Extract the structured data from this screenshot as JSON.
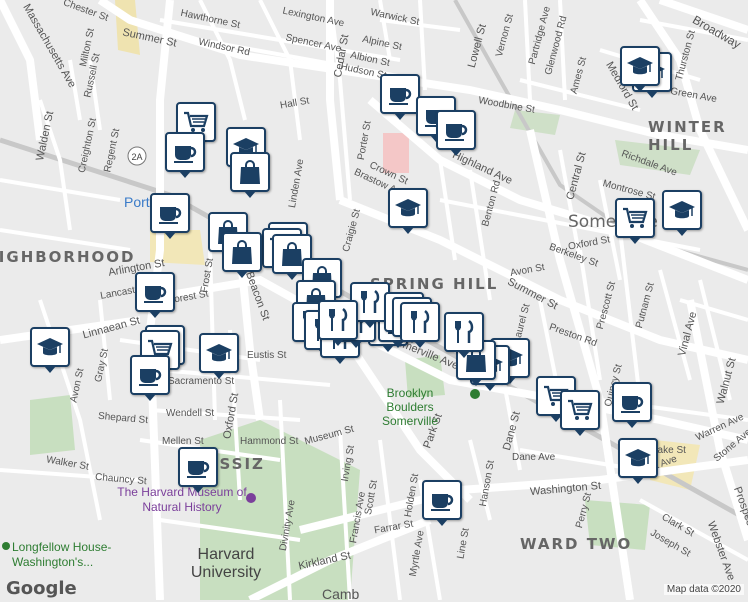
{
  "streets": [
    "Summer St",
    "Hawthorne St",
    "Windsor Rd",
    "Lexington Ave",
    "Spencer Ave",
    "Cedar St",
    "Alpine St",
    "Hudson St",
    "Albion St",
    "Warwick St",
    "Lowell St",
    "Vernon St",
    "Partridge Ave",
    "Glenwood Rd",
    "Ames St",
    "Central St",
    "Thurston St",
    "Medford St",
    "Broadway",
    "Woodbine St",
    "Green Ave",
    "Richdale Ave",
    "Highland Ave",
    "Montrose St",
    "Porter St",
    "Crown St",
    "Brastow Ave",
    "Benton Rd",
    "Oxford St",
    "Berkeley St",
    "Avon St",
    "Summer St",
    "Preston Rd",
    "Laurel St",
    "Prescott St",
    "Putnam St",
    "Vinal Ave",
    "Walnut St",
    "Quincy St",
    "Somerville Ave",
    "Craigie St",
    "Linden Ave",
    "Hall St",
    "Walden St",
    "Creighton St",
    "Regent St",
    "Russell St",
    "Milton St",
    "Chester St",
    "Massachusetts Ave",
    "Arlington St",
    "Lancaster St",
    "Forest St",
    "Frost St",
    "Beacon St",
    "Oxford St",
    "Linnaean St",
    "Avon St",
    "Gray St",
    "Eustis St",
    "Sacramento St",
    "Wendell St",
    "Shepard St",
    "Mellen St",
    "Hammond St",
    "Museum St",
    "Irving St",
    "Scott St",
    "Francis Ave",
    "Holden St",
    "Farrar St",
    "Myrtle Ave",
    "Line St",
    "Dane Ave",
    "Hanson St",
    "Park St",
    "Dane St",
    "Washington St",
    "Kirkland St",
    "Walker St",
    "Chauncy St",
    "Divinity Ave",
    "Perry St",
    "Clark St",
    "Joseph St",
    "Webster Ave",
    "Stone Ave",
    "Warren Ave",
    "Park Ave",
    "Prospect St",
    "Lake St"
  ],
  "neighborhoods": [
    "WINTER HILL",
    "Somerville",
    "SPRING HILL",
    "AGASSIZ",
    "WARD TWO",
    "NEIGHBORHOOD"
  ],
  "pois": [
    "Porter",
    "Brooklyn Boulders Somerville",
    "The Harvard Museum of Natural History",
    "Longfellow House-Washington's...",
    "Harvard University",
    "Camb"
  ],
  "route_badge": "2A",
  "attribution": {
    "google": "Google",
    "map_data": "Map data ©2020"
  },
  "colors": {
    "marker_border": "#1b3f63",
    "park": "#c8dfc0",
    "road": "#ffffff",
    "rail": "#c8c8c8",
    "label": "#555555"
  },
  "markers": [
    {
      "type": "shopping-cart"
    },
    {
      "type": "shopping-cart"
    },
    {
      "type": "shopping-cart"
    },
    {
      "type": "shopping-cart"
    },
    {
      "type": "shopping-cart"
    },
    {
      "type": "shopping-cart"
    },
    {
      "type": "shopping-cart"
    },
    {
      "type": "shopping-cart"
    },
    {
      "type": "coffee-cup"
    },
    {
      "type": "coffee-cup"
    },
    {
      "type": "coffee-cup"
    },
    {
      "type": "coffee-cup"
    },
    {
      "type": "coffee-cup"
    },
    {
      "type": "coffee-cup"
    },
    {
      "type": "coffee-cup"
    },
    {
      "type": "coffee-cup"
    },
    {
      "type": "coffee-cup"
    },
    {
      "type": "coffee-cup"
    },
    {
      "type": "graduation-cap"
    },
    {
      "type": "graduation-cap"
    },
    {
      "type": "graduation-cap"
    },
    {
      "type": "graduation-cap"
    },
    {
      "type": "graduation-cap"
    },
    {
      "type": "graduation-cap"
    },
    {
      "type": "graduation-cap"
    },
    {
      "type": "graduation-cap"
    },
    {
      "type": "graduation-cap"
    },
    {
      "type": "graduation-cap"
    },
    {
      "type": "shopping-bag"
    },
    {
      "type": "shopping-bag"
    },
    {
      "type": "shopping-bag"
    },
    {
      "type": "shopping-bag"
    },
    {
      "type": "shopping-bag"
    },
    {
      "type": "shopping-bag"
    },
    {
      "type": "shopping-bag"
    },
    {
      "type": "shopping-bag"
    },
    {
      "type": "shopping-bag"
    },
    {
      "type": "fork-knife"
    },
    {
      "type": "fork-knife"
    },
    {
      "type": "fork-knife"
    },
    {
      "type": "fork-knife"
    },
    {
      "type": "fork-knife"
    },
    {
      "type": "fork-knife"
    },
    {
      "type": "fork-knife"
    },
    {
      "type": "fork-knife"
    },
    {
      "type": "fork-knife"
    },
    {
      "type": "fork-knife"
    }
  ]
}
